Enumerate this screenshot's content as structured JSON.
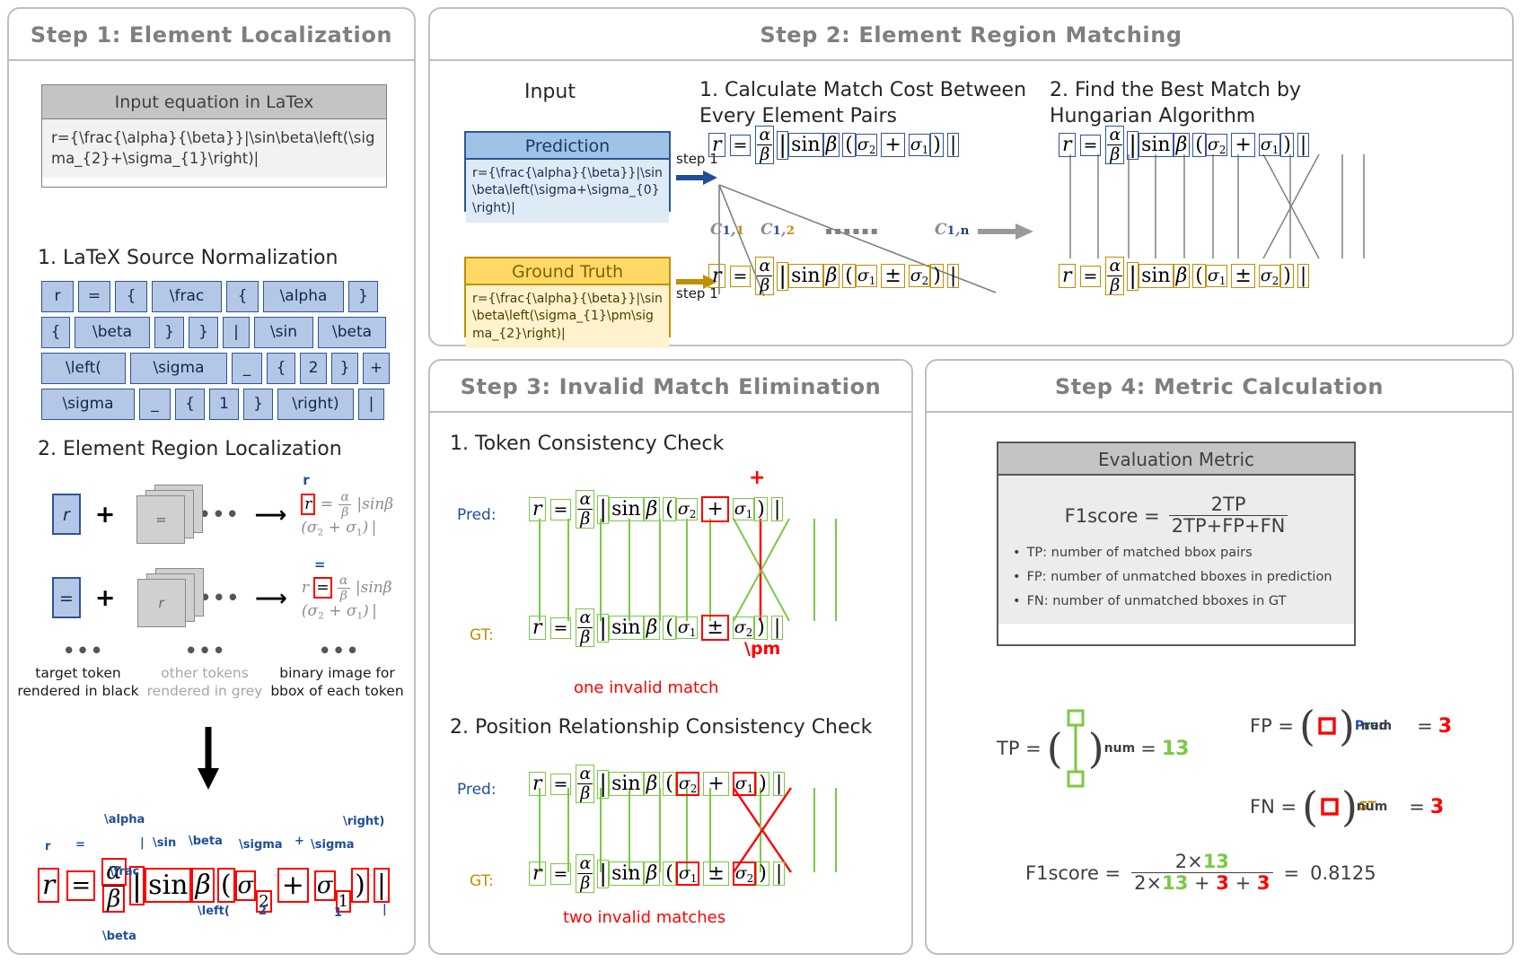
{
  "steps": {
    "step1": {
      "title": "Step 1: Element Localization",
      "input_box": {
        "header": "Input equation in LaTex",
        "latex": "r={\\frac{\\alpha}{\\beta}}|\\sin\\beta\\left(\\sigma_{2}+\\sigma_{1}\\right)|"
      },
      "sub1_title": "1. LaTeX Source Normalization",
      "tokens": [
        [
          "r",
          "=",
          "{",
          "\\frac",
          "{",
          "\\alpha",
          "}"
        ],
        [
          "{",
          "\\beta",
          "}",
          "}",
          "|",
          "\\sin",
          "\\beta"
        ],
        [
          "\\left(",
          "\\sigma",
          "_",
          "{",
          "2",
          "}",
          "+"
        ],
        [
          "\\sigma",
          "_",
          "{",
          "1",
          "}",
          "\\right)",
          "|"
        ]
      ],
      "sub2_title": "2. Element Region Localization",
      "rows": [
        {
          "target": "r",
          "other": "=",
          "dots": "•••"
        },
        {
          "target": "=",
          "other": "r",
          "dots": "•••"
        }
      ],
      "ellipsis": "•••",
      "captions": [
        "target token\nrendered in black",
        "other tokens\nrendered in grey",
        "binary image for\nbbox of each token"
      ],
      "annotations": [
        "r",
        "=",
        "\\alpha",
        "\\frac",
        "\\beta",
        "|",
        "\\sin",
        "\\beta",
        "\\left(",
        "\\sigma",
        "2",
        "+",
        "\\sigma",
        "1",
        "\\right)",
        "|"
      ]
    },
    "step2": {
      "title": "Step 2: Element Region Matching",
      "input_label": "Input",
      "col1_title": "1. Calculate Match Cost Between\nEvery Element Pairs",
      "col2_title": "2. Find the Best Match by\nHungarian Algorithm",
      "prediction": {
        "header": "Prediction",
        "latex": "r={\\frac{\\alpha}{\\beta}}|\\sin\\beta\\left(\\sigma+\\sigma_{0}\\right)|"
      },
      "ground_truth": {
        "header": "Ground Truth",
        "latex": "r={\\frac{\\alpha}{\\beta}}|\\sin\\beta\\left(\\sigma_{1}\\pm\\sigma_{2}\\right)|"
      },
      "step_arrow_label": "step 1",
      "costs": [
        {
          "c": "C",
          "s1": "1",
          "s2": "1"
        },
        {
          "c": "C",
          "s1": "1",
          "s2": "2"
        },
        {
          "c": "C",
          "s1": "1",
          "s2": "n"
        }
      ],
      "cost_ellipsis": "▪▪▪▪▪▪"
    },
    "step3": {
      "title": "Step 3: Invalid Match Elimination",
      "sub1_title": "1. Token Consistency Check",
      "sub2_title": "2. Position Relationship Consistency Check",
      "pred_label": "Pred:",
      "gt_label": "GT:",
      "plus_token": "+",
      "pm_token": "\\pm",
      "caption1": "one invalid match",
      "caption2": "two invalid matches"
    },
    "step4": {
      "title": "Step 4: Metric Calculation",
      "metric_box": {
        "header": "Evaluation Metric",
        "formula_label": "F1score  =",
        "numerator": "2TP",
        "denominator": "2TP+FP+FN",
        "bullets": [
          "TP:  number of matched bbox pairs",
          "FP: number of unmatched bboxes in prediction",
          "FN: number of unmatched bboxes in GT"
        ]
      },
      "tp": {
        "label": "TP =",
        "sub": "num",
        "eq": "=",
        "value": "13"
      },
      "fp": {
        "label": "FP =",
        "sup": "Pred",
        "sub": "num",
        "eq": "=",
        "value": "3"
      },
      "fn": {
        "label": "FN =",
        "sup": "GT",
        "sub": "num",
        "eq": "=",
        "value": "3"
      },
      "final": {
        "label": "F1score  =",
        "num_a": "2×",
        "num_b": "13",
        "den_a": "2×",
        "den_b": "13",
        "den_c": " + ",
        "den_d": "3",
        "den_e": " + ",
        "den_f": "3",
        "eq": "=",
        "result": "0.8125"
      }
    }
  },
  "colors": {
    "blue": "#2f5597",
    "gold": "#bf9000",
    "green": "#7ac943",
    "red": "#ff0000",
    "grey": "#7f7f7f"
  }
}
